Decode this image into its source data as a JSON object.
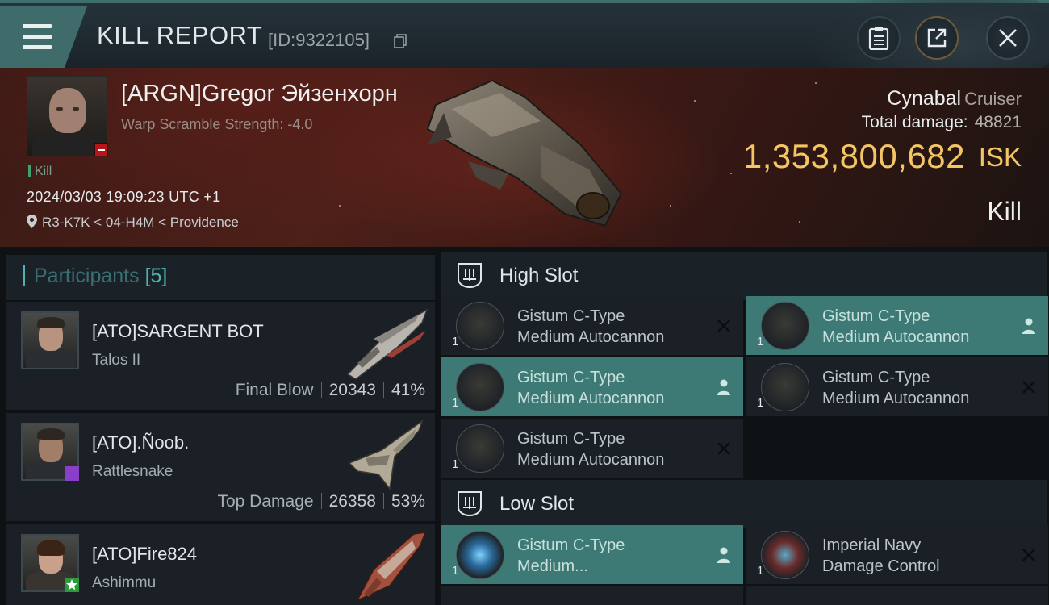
{
  "header": {
    "title": "KILL REPORT",
    "kill_id": "[ID:9322105]",
    "icons": [
      "menu-icon",
      "copy-icon",
      "clipboard-icon",
      "share-icon",
      "close-icon"
    ]
  },
  "victim": {
    "name": "[ARGN]Gregor Эйзенхорн",
    "scramble": "Warp Scramble Strength: -4.0",
    "status": "Kill",
    "time": "2024/03/03 19:09:23 UTC +1",
    "location": "R3-K7K < 04-H4M < Providence",
    "ship": "Cynabal",
    "ship_class": "Cruiser",
    "total_damage_label": "Total damage:",
    "total_damage": "48821",
    "isk_value": "1,353,800,682",
    "isk_unit": "ISK",
    "result": "Kill"
  },
  "participants": {
    "title": "Participants",
    "count": "[5]",
    "items": [
      {
        "name": "[ATO]SARGENT BOT",
        "ship": "Talos II",
        "label": "Final Blow",
        "damage": "20343",
        "percent": "41%"
      },
      {
        "name": "[ATO].Ñoob.",
        "ship": "Rattlesnake",
        "label": "Top Damage",
        "damage": "26358",
        "percent": "53%"
      },
      {
        "name": "[ATO]Fire824",
        "ship": "Ashimmu"
      }
    ]
  },
  "fitting": {
    "high_slot": "High Slot",
    "low_slot": "Low Slot",
    "modules": [
      {
        "line1": "Gistum C-Type",
        "line2": "Medium Autocannon",
        "qty": "1"
      },
      {
        "line1": "Gistum C-Type",
        "line2": "Medium Autocannon",
        "qty": "1"
      },
      {
        "line1": "Gistum C-Type",
        "line2": "Medium Autocannon",
        "qty": "1"
      },
      {
        "line1": "Gistum C-Type",
        "line2": "Medium Autocannon",
        "qty": "1"
      },
      {
        "line1": "Gistum C-Type",
        "line2": "Medium Autocannon",
        "qty": "1"
      },
      {
        "line1": "Gistum C-Type",
        "line2": "Medium...",
        "qty": "1"
      },
      {
        "line1": "Imperial Navy",
        "line2": "Damage Control",
        "qty": "1"
      }
    ]
  },
  "colors": {
    "accent": "#4fb2b4",
    "active_module": "#3d7a75",
    "isk": "#f3c563",
    "kill_status": "#3fa070"
  }
}
